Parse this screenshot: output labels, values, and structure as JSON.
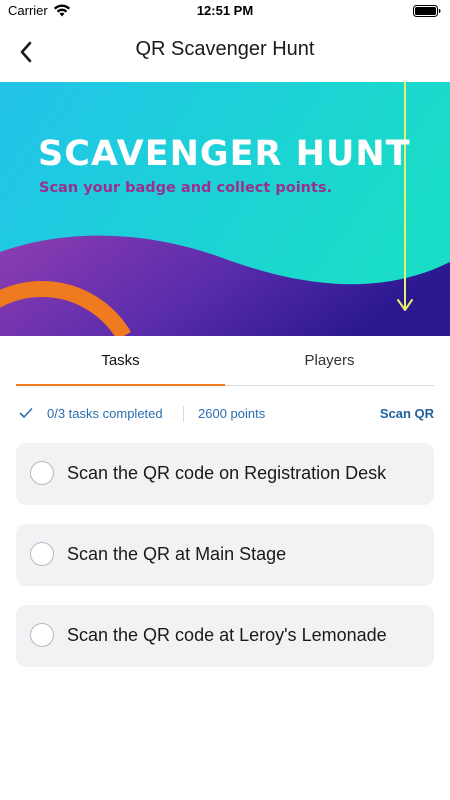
{
  "status_bar": {
    "carrier": "Carrier",
    "time": "12:51 PM"
  },
  "nav": {
    "title": "QR Scavenger Hunt",
    "back_icon": "chevron-left-icon"
  },
  "banner": {
    "title": "SCAVENGER HUNT",
    "subtitle": "Scan your badge and collect points.",
    "colors": {
      "top_gradient_start": "#22c3e8",
      "top_gradient_end": "#1ddcc7",
      "wave_start": "#8c3cb0",
      "wave_end": "#2a1a8c",
      "arc": "#f07a20",
      "arrow": "#e8f06a",
      "subtitle": "#9b2f8c"
    }
  },
  "tabs": [
    {
      "label": "Tasks",
      "active": true
    },
    {
      "label": "Players",
      "active": false
    }
  ],
  "progress": {
    "tasks_text": "0/3 tasks completed",
    "points_text": "2600 points",
    "scan_label": "Scan QR"
  },
  "tasks": [
    {
      "label": "Scan the QR code on Registration Desk",
      "completed": false
    },
    {
      "label": "Scan the QR at Main Stage",
      "completed": false
    },
    {
      "label": "Scan the QR code at Leroy's Lemonade",
      "completed": false
    }
  ],
  "accent_color": "#ef7d22",
  "link_color": "#1f5f9e"
}
